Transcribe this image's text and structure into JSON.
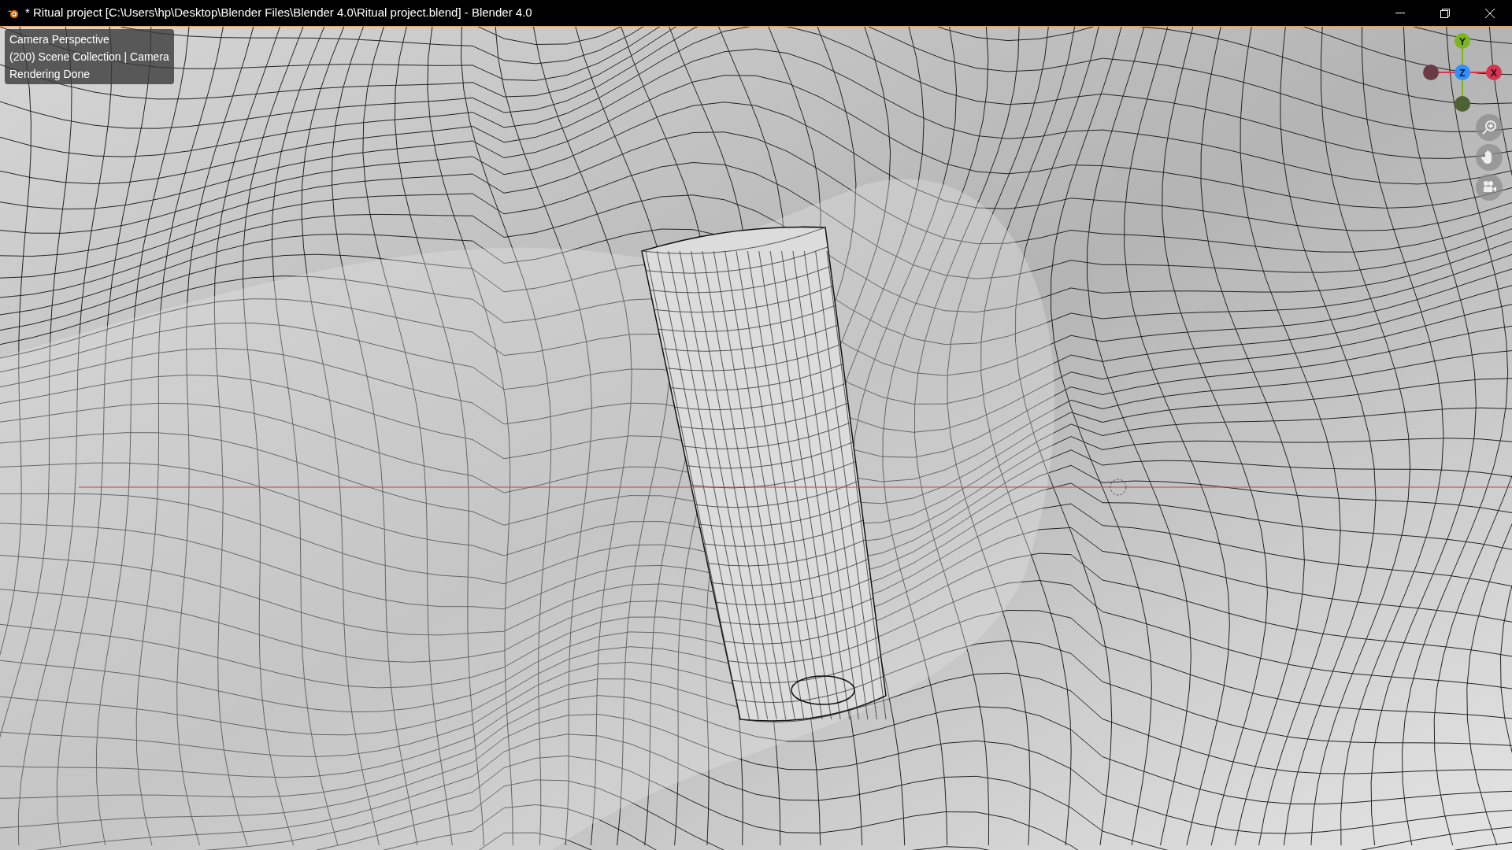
{
  "window": {
    "title": "* Ritual project [C:\\Users\\hp\\Desktop\\Blender Files\\Blender 4.0\\Ritual project.blend] - Blender 4.0"
  },
  "viewport": {
    "overlay_lines": [
      "Camera Perspective",
      "(200) Scene Collection | Camera",
      "Rendering Done"
    ]
  },
  "gizmo": {
    "axes": [
      {
        "kind": "positive",
        "label": "Y",
        "color": "#7bb61c"
      },
      {
        "kind": "positive",
        "label": "Z",
        "color": "#2f8fff"
      },
      {
        "kind": "positive",
        "label": "X",
        "color": "#d9344e"
      },
      {
        "kind": "negative",
        "color": "#6b3a44"
      },
      {
        "kind": "negative",
        "color": "#4c6232"
      }
    ]
  }
}
